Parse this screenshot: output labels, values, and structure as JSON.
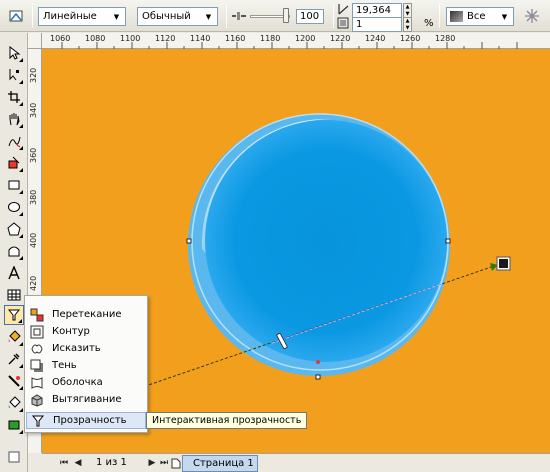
{
  "propbar": {
    "transparency_type": "Линейные",
    "merge_mode": "Обычный",
    "opacity_value": "100",
    "opacity_fraction": 1.0,
    "angle_value": "19,364",
    "border_value": "1",
    "border_unit": "%",
    "apply_to": "Все"
  },
  "ruler": {
    "top": [
      "1060",
      "1080",
      "1100",
      "1120",
      "1140",
      "1160",
      "1180",
      "1200",
      "1220",
      "1240",
      "1260",
      "1280"
    ],
    "left": [
      "320",
      "340",
      "360",
      "380",
      "400",
      "420"
    ]
  },
  "flyout": {
    "items": [
      {
        "label": "Перетекание",
        "icon": "blend-icon"
      },
      {
        "label": "Контур",
        "icon": "contour-icon"
      },
      {
        "label": "Исказить",
        "icon": "distort-icon"
      },
      {
        "label": "Тень",
        "icon": "shadow-icon"
      },
      {
        "label": "Оболочка",
        "icon": "envelope-icon"
      },
      {
        "label": "Вытягивание",
        "icon": "extrude-icon"
      },
      {
        "label": "Прозрачность",
        "icon": "transparency-icon"
      }
    ]
  },
  "tooltip": "Интерактивная прозрачность",
  "pagenav": {
    "page_count": "1 из 1",
    "page_tab": "Страница 1"
  },
  "colors": {
    "canvas": "#f29f1e",
    "sphere": "#0797e0",
    "highlight_menu": "#dde7f5"
  }
}
